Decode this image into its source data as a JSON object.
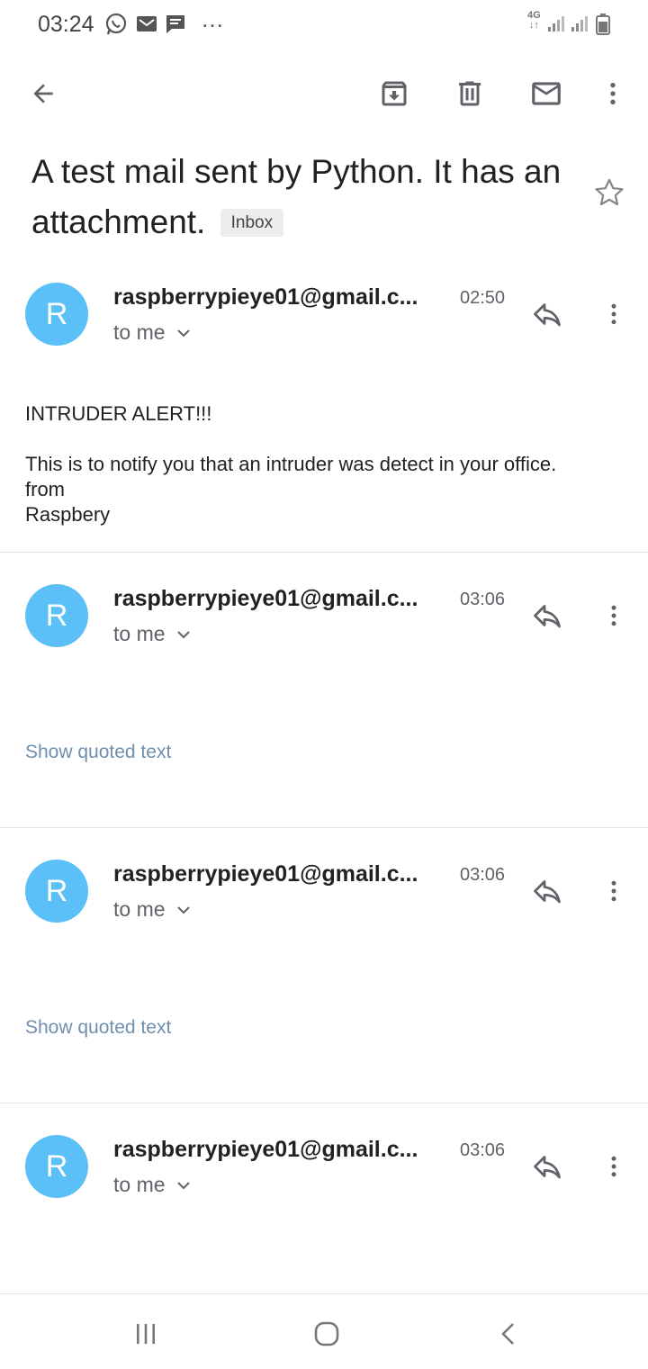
{
  "status_bar": {
    "time": "03:24",
    "icons": [
      "whatsapp-icon",
      "gmail-notification-icon",
      "message-icon",
      "more-notifications-icon"
    ],
    "network": "4G",
    "right_icons": [
      "signal-icon",
      "signal-icon",
      "battery-icon"
    ]
  },
  "toolbar": {
    "icons": [
      "back-arrow-icon",
      "archive-icon",
      "delete-icon",
      "mark-unread-icon",
      "more-vert-icon"
    ]
  },
  "subject": {
    "title": "A test mail sent by Python. It has an attachment.",
    "label": "Inbox"
  },
  "messages": [
    {
      "avatar_letter": "R",
      "sender": "raspberrypieye01@gmail.c...",
      "time": "02:50",
      "recipient": "to me",
      "body_line1": "INTRUDER ALERT!!!",
      "body_line2": "This is to notify you that an intruder was detect in your office.\n from\nRaspbery"
    },
    {
      "avatar_letter": "R",
      "sender": "raspberrypieye01@gmail.c...",
      "time": "03:06",
      "recipient": "to me",
      "quoted_link": "Show quoted text"
    },
    {
      "avatar_letter": "R",
      "sender": "raspberrypieye01@gmail.c...",
      "time": "03:06",
      "recipient": "to me",
      "quoted_link": "Show quoted text"
    },
    {
      "avatar_letter": "R",
      "sender": "raspberrypieye01@gmail.c...",
      "time": "03:06",
      "recipient": "to me"
    }
  ],
  "nav_bar": {
    "icons": [
      "recent-apps-icon",
      "home-icon",
      "back-icon"
    ]
  },
  "colors": {
    "avatar": "#5bc0f8",
    "link": "#6f8faf",
    "icon": "#5f6368"
  }
}
